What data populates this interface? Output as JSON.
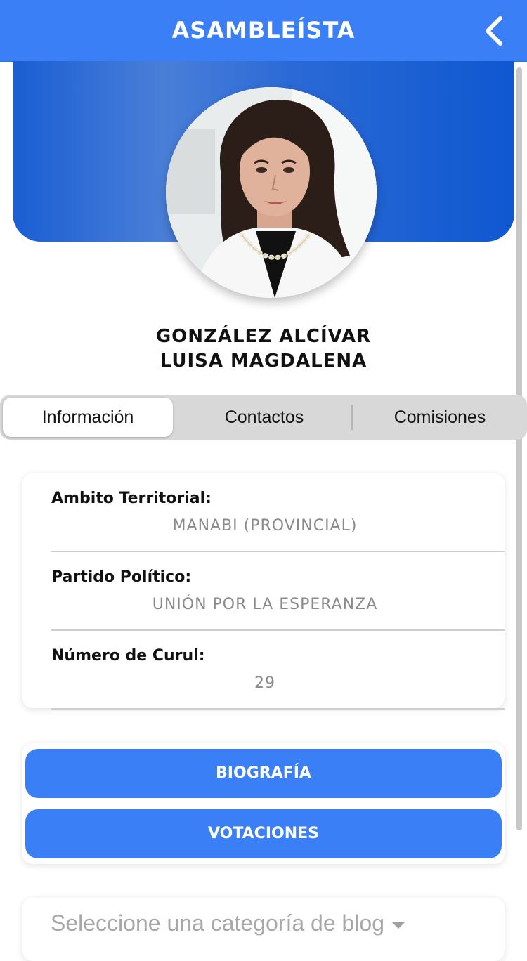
{
  "header": {
    "title": "ASAMBLEÍSTA",
    "back_icon": "chevron-left-icon"
  },
  "profile": {
    "name_line1": "GONZÁLEZ ALCÍVAR",
    "name_line2": "LUISA MAGDALENA"
  },
  "tabs": [
    {
      "label": "Información",
      "active": true
    },
    {
      "label": "Contactos",
      "active": false
    },
    {
      "label": "Comisiones",
      "active": false
    }
  ],
  "info": [
    {
      "label": "Ambito Territorial:",
      "value": "MANABI (PROVINCIAL)"
    },
    {
      "label": "Partido Político:",
      "value": "UNIÓN POR LA ESPERANZA"
    },
    {
      "label": "Número de Curul:",
      "value": "29"
    }
  ],
  "actions": {
    "biografia": "BIOGRAFÍA",
    "votaciones": "VOTACIONES"
  },
  "blog": {
    "placeholder": "Seleccione una categoría de blog"
  },
  "colors": {
    "primary": "#3a7ff6",
    "hero_dark": "#0f58d0",
    "tab_bg": "#d8d8d8",
    "muted_text": "#8a8a8a"
  }
}
